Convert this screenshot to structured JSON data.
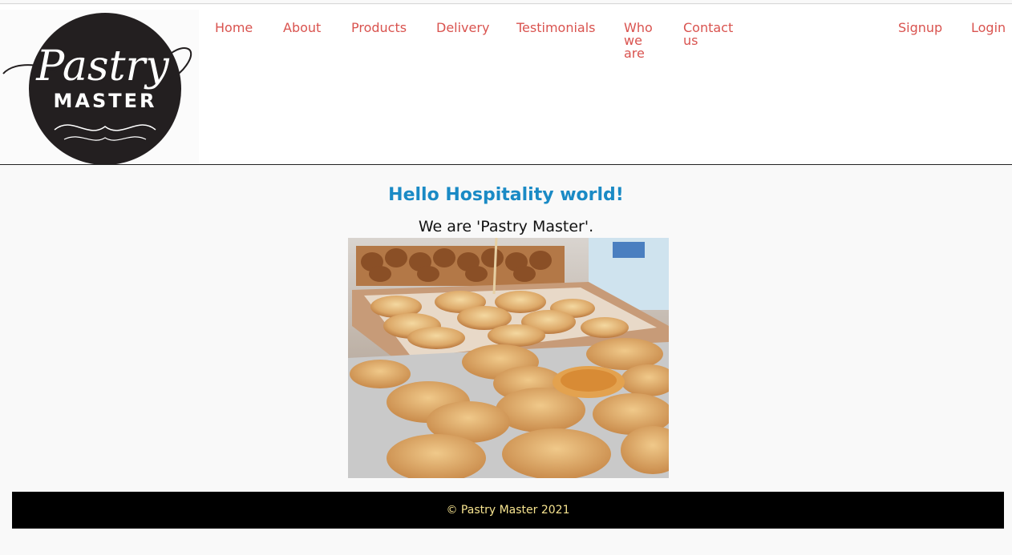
{
  "logo": {
    "script_text": "Pastry",
    "word_text": "MASTER"
  },
  "nav": {
    "home": "Home",
    "about": "About",
    "products": "Products",
    "delivery": "Delivery",
    "testimonials": "Testimonials",
    "who_line1": "Who",
    "who_line2": "we",
    "who_line3": "are",
    "contact_line1": "Contact",
    "contact_line2": "us",
    "signup": "Signup",
    "login": "Login"
  },
  "main": {
    "heading": "Hello Hospitality world!",
    "tagline": "We are 'Pastry Master'."
  },
  "footer": {
    "copyright": "© Pastry Master 2021"
  },
  "colors": {
    "nav_link": "#d9534f",
    "heading": "#1a8ac5",
    "footer_bg": "#000000",
    "footer_text": "#f6e38f",
    "page_bg": "#f9f9f9"
  }
}
